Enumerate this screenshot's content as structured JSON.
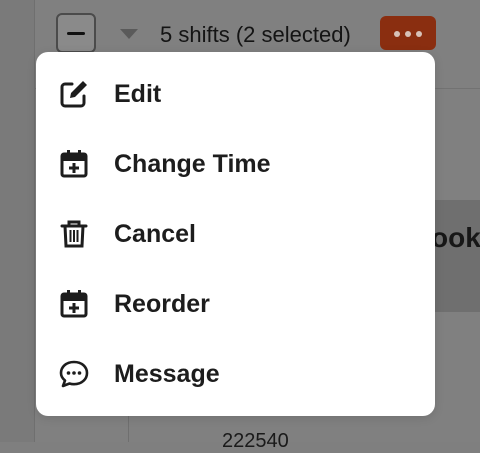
{
  "toolbar": {
    "shift_count_label": "5 shifts",
    "selected_label": "(2 selected)",
    "more_button_color": "#8a2e10"
  },
  "menu": {
    "items": [
      {
        "label": "Edit",
        "icon": "edit-icon"
      },
      {
        "label": "Change Time",
        "icon": "calendar-plus-icon"
      },
      {
        "label": "Cancel",
        "icon": "trash-icon"
      },
      {
        "label": "Reorder",
        "icon": "calendar-plus-icon"
      },
      {
        "label": "Message",
        "icon": "chat-bubble-icon"
      }
    ]
  },
  "background": {
    "panel_text": "ook",
    "row_text": "222540"
  }
}
